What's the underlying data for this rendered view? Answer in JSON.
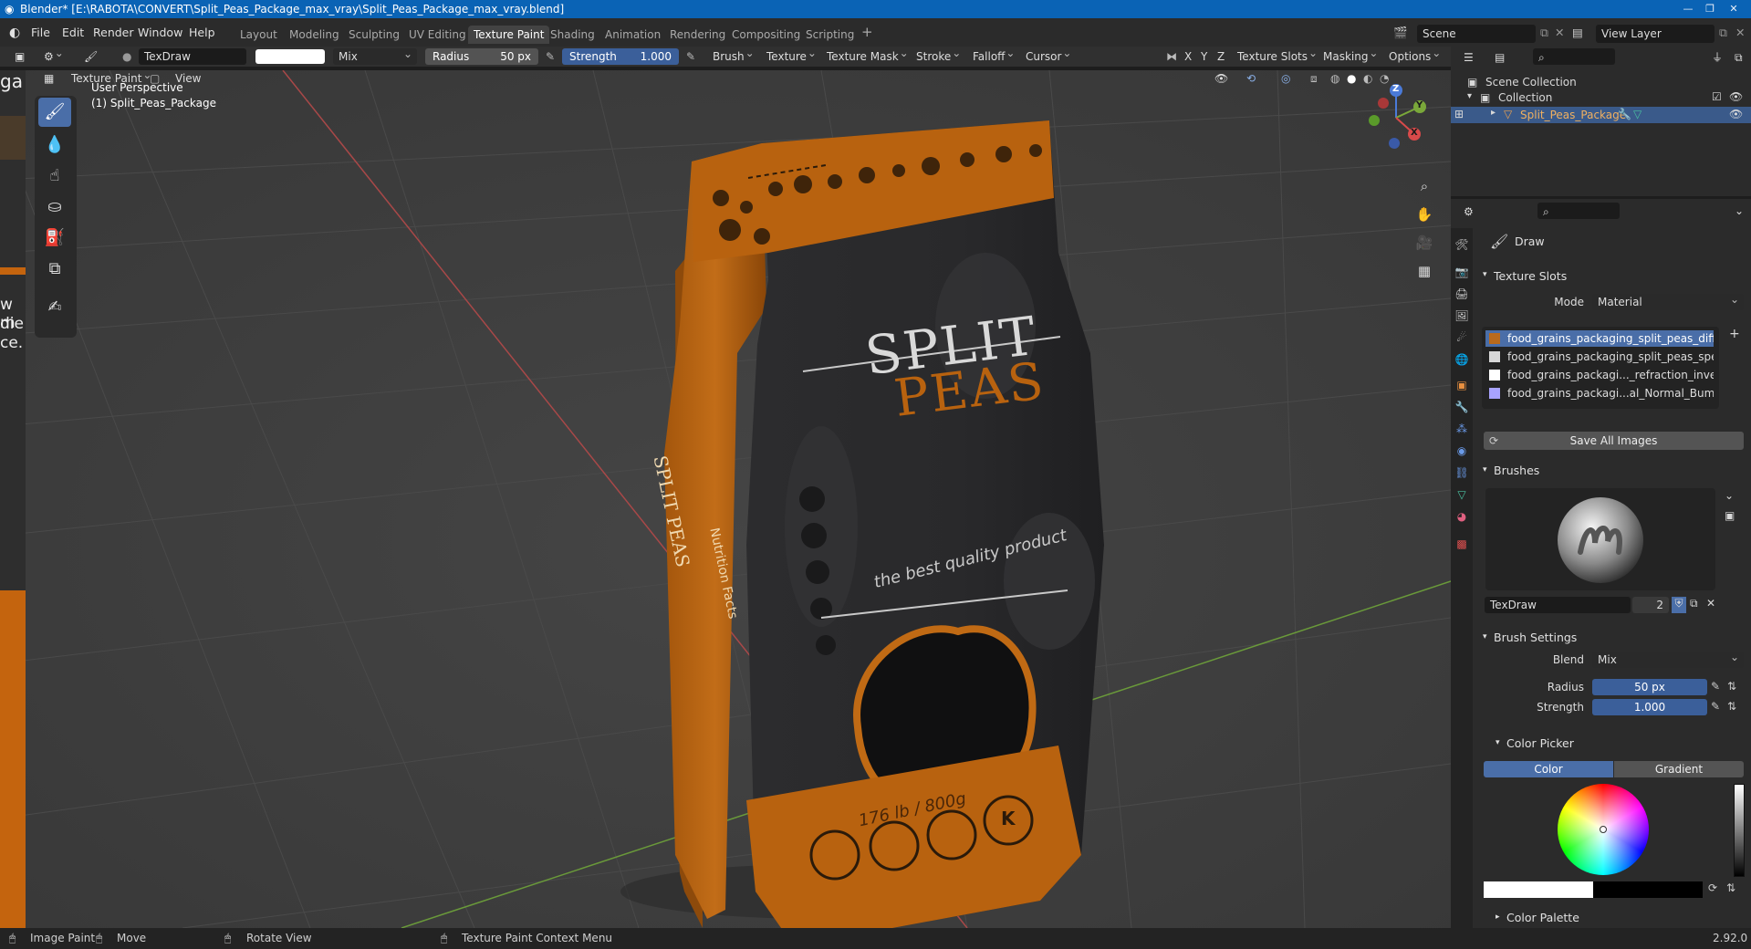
{
  "window": {
    "title": "Blender* [E:\\RABOTA\\CONVERT\\Split_Peas_Package_max_vray\\Split_Peas_Package_max_vray.blend]"
  },
  "menu": [
    "File",
    "Edit",
    "Render",
    "Window",
    "Help"
  ],
  "workspaces": [
    "Layout",
    "Modeling",
    "Sculpting",
    "UV Editing",
    "Texture Paint",
    "Shading",
    "Animation",
    "Rendering",
    "Compositing",
    "Scripting"
  ],
  "active_workspace": "Texture Paint",
  "topright": {
    "scene": "Scene",
    "view_layer": "View Layer"
  },
  "tool_header": {
    "brush_name": "TexDraw",
    "blend": "Mix",
    "radius_label": "Radius",
    "radius_value": "50 px",
    "strength_label": "Strength",
    "strength_value": "1.000",
    "menus": [
      "Brush",
      "Texture",
      "Texture Mask",
      "Stroke",
      "Falloff",
      "Cursor"
    ],
    "axes": [
      "X",
      "Y",
      "Z"
    ],
    "right_menus": [
      "Texture Slots",
      "Masking",
      "Options"
    ]
  },
  "viewport_header": {
    "mode": "Texture Paint",
    "view": "View"
  },
  "viewport": {
    "perspective": "User Perspective",
    "object": "(1) Split_Peas_Package",
    "gizmo_axes": [
      "Z",
      "Y",
      "X"
    ]
  },
  "package": {
    "title_line1": "SPLIT",
    "title_line2": "PEAS",
    "tagline": "the best quality product",
    "weight": "176 lb / 800g",
    "side_title": "SPLIT PEAS",
    "side_label": "Nutrition Facts",
    "badge_k": "K"
  },
  "outliner": {
    "scene_collection": "Scene Collection",
    "collection": "Collection",
    "object": "Split_Peas_Package"
  },
  "properties": {
    "tool_name": "Draw",
    "texture_slots_header": "Texture Slots",
    "mode_label": "Mode",
    "mode_value": "Material",
    "slots": [
      {
        "name": "food_grains_packaging_split_peas_diffuse.p...",
        "color": "#b96a1c"
      },
      {
        "name": "food_grains_packaging_split_peas_specula...",
        "color": "#d8d8d8"
      },
      {
        "name": "food_grains_packagi..._refraction_invert.png",
        "color": "#ffffff"
      },
      {
        "name": "food_grains_packagi...al_Normal_Bump.tga",
        "color": "#a8a3ff"
      }
    ],
    "save_all_images": "Save All Images",
    "brushes_header": "Brushes",
    "brush_name": "TexDraw",
    "brush_users": "2",
    "brush_settings_header": "Brush Settings",
    "blend_label": "Blend",
    "blend_value": "Mix",
    "radius_label": "Radius",
    "radius_value": "50 px",
    "strength_label": "Strength",
    "strength_value": "1.000",
    "color_picker_header": "Color Picker",
    "color_tab": "Color",
    "gradient_tab": "Gradient",
    "color_palette_header": "Color Palette"
  },
  "left_fragment": [
    "ga",
    "w m",
    "die",
    "ce."
  ],
  "status": {
    "image_paint": "Image Paint",
    "move": "Move",
    "rotate_view": "Rotate View",
    "context_menu": "Texture Paint Context Menu",
    "version": "2.92.0"
  },
  "colors": {
    "accent": "#4a6ea8",
    "titlebar": "#0a63b5",
    "package_orange": "#b8620f"
  }
}
